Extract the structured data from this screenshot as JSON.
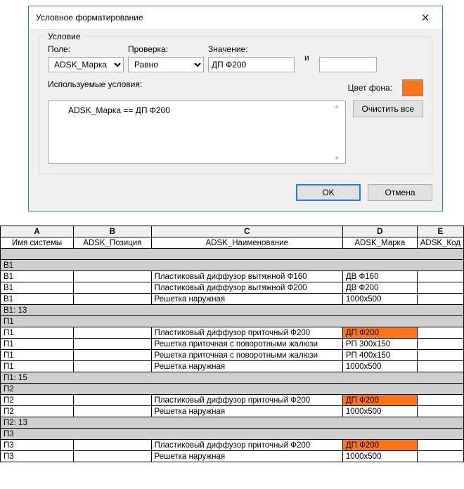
{
  "dialog": {
    "title": "Условное форматирование",
    "group_label": "Условие",
    "field_label": "Поле:",
    "check_label": "Проверка:",
    "value_label": "Значение:",
    "field_value": "ADSK_Марка",
    "check_value": "Равно",
    "value_value": "ДП Ф200",
    "and_label": "и",
    "value2_value": "",
    "used_label": "Используемые условия:",
    "color_label": "Цвет фона:",
    "color_hex": "#ff7518",
    "condition_text": "ADSK_Марка == ДП Ф200",
    "clear_btn": "Очистить все",
    "ok_btn": "OK",
    "cancel_btn": "Отмена"
  },
  "sheet": {
    "col_letters": [
      "A",
      "B",
      "C",
      "D",
      "E"
    ],
    "headers": [
      "Имя системы",
      "ADSK_Позиция",
      "ADSK_Наименование",
      "ADSK_Марка",
      "ADSK_Код"
    ],
    "rows": [
      {
        "type": "group",
        "cells": [
          "",
          "",
          "",
          "",
          ""
        ]
      },
      {
        "type": "group",
        "cells": [
          "В1",
          "",
          "",
          "",
          ""
        ]
      },
      {
        "type": "data",
        "cells": [
          "В1",
          "",
          "Пластиковый диффузор вытяжной Ф160",
          "ДВ Ф160",
          ""
        ]
      },
      {
        "type": "data",
        "cells": [
          "В1",
          "",
          "Пластиковый диффузор вытяжной Ф200",
          "ДВ Ф200",
          ""
        ]
      },
      {
        "type": "data",
        "cells": [
          "В1",
          "",
          "Решетка наружная",
          "1000х500",
          ""
        ]
      },
      {
        "type": "group",
        "cells": [
          "В1: 13",
          "",
          "",
          "",
          ""
        ]
      },
      {
        "type": "group",
        "cells": [
          "П1",
          "",
          "",
          "",
          ""
        ]
      },
      {
        "type": "data",
        "cells": [
          "П1",
          "",
          "Пластиковый диффузор приточный Ф200",
          "ДП Ф200",
          ""
        ],
        "hl": [
          3
        ]
      },
      {
        "type": "data",
        "cells": [
          "П1",
          "",
          "Решетка приточная с поворотными жалюзи",
          "РП 300х150",
          ""
        ]
      },
      {
        "type": "data",
        "cells": [
          "П1",
          "",
          "Решетка приточная с поворотными жалюзи",
          "РП 400х150",
          ""
        ]
      },
      {
        "type": "data",
        "cells": [
          "П1",
          "",
          "Решетка наружная",
          "1000х500",
          ""
        ]
      },
      {
        "type": "group",
        "cells": [
          "П1: 15",
          "",
          "",
          "",
          ""
        ]
      },
      {
        "type": "group",
        "cells": [
          "П2",
          "",
          "",
          "",
          ""
        ]
      },
      {
        "type": "data",
        "cells": [
          "П2",
          "",
          "Пластиковый диффузор приточный Ф200",
          "ДП Ф200",
          ""
        ],
        "hl": [
          3
        ]
      },
      {
        "type": "data",
        "cells": [
          "П2",
          "",
          "Решетка наружная",
          "1000х500",
          ""
        ]
      },
      {
        "type": "group",
        "cells": [
          "П2: 13",
          "",
          "",
          "",
          ""
        ]
      },
      {
        "type": "group",
        "cells": [
          "П3",
          "",
          "",
          "",
          ""
        ]
      },
      {
        "type": "data",
        "cells": [
          "П3",
          "",
          "Пластиковый диффузор приточный Ф200",
          "ДП Ф200",
          ""
        ],
        "hl": [
          3
        ]
      },
      {
        "type": "data",
        "cells": [
          "П3",
          "",
          "Решетка наружная",
          "1000х500",
          ""
        ]
      }
    ]
  }
}
